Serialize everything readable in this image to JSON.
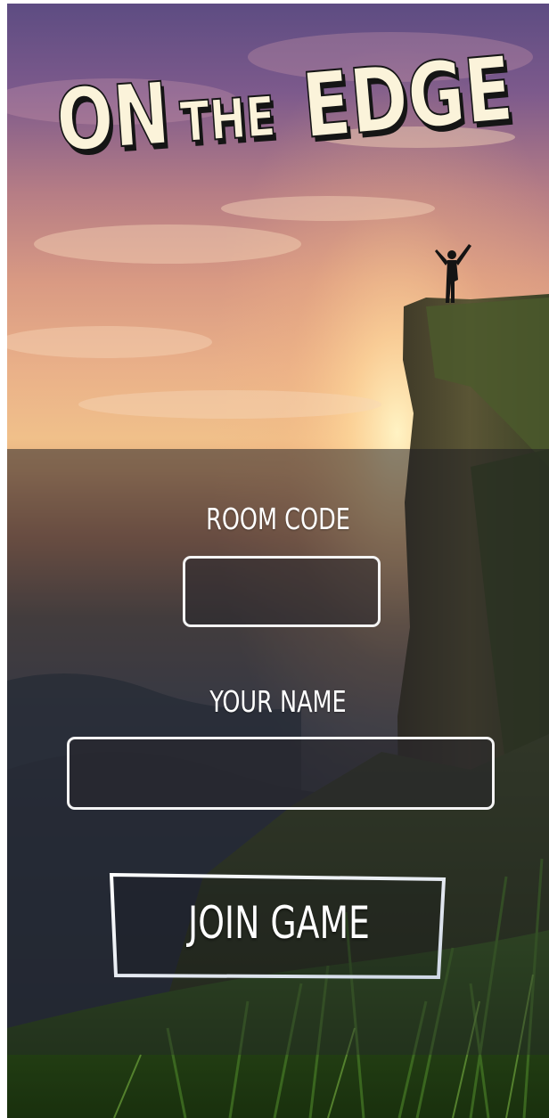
{
  "game": {
    "title_words": [
      "ON",
      "THE",
      "EDGE"
    ]
  },
  "form": {
    "room_code_label": "ROOM CODE",
    "room_code_value": "",
    "your_name_label": "YOUR NAME",
    "your_name_value": "",
    "join_label": "JOIN GAME"
  },
  "colors": {
    "title_fill": "#fbf3da",
    "title_shadow": "#1a1a1a",
    "field_border": "#f4f4f4",
    "text": "#ffffff"
  }
}
